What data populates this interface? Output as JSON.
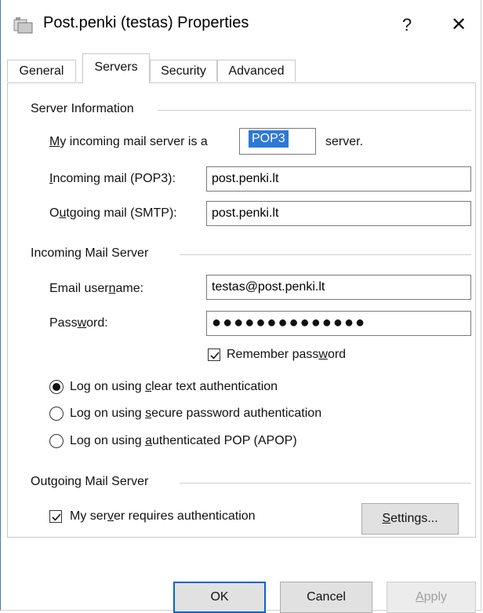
{
  "window": {
    "title": "Post.penki (testas) Properties",
    "help_label": "?",
    "close_label": "✕"
  },
  "tabs": [
    {
      "label": "General",
      "active": false
    },
    {
      "label": "Servers",
      "active": true
    },
    {
      "label": "Security",
      "active": false
    },
    {
      "label": "Advanced",
      "active": false
    }
  ],
  "server_info": {
    "group_label": "Server Information",
    "incoming_type_label_pre": "My incoming mail server is a",
    "incoming_type_value": "POP3",
    "incoming_type_label_post": "server.",
    "incoming_mail_label": "Incoming mail (POP3):",
    "incoming_mail_value": "post.penki.lt",
    "outgoing_mail_label": "Outgoing mail (SMTP):",
    "outgoing_mail_value": "post.penki.lt"
  },
  "incoming_server": {
    "group_label": "Incoming Mail Server",
    "username_label": "Email username:",
    "username_value": "testas@post.penki.lt",
    "password_label": "Password:",
    "password_value": "●●●●●●●●●●●●●●",
    "remember_password_label": "Remember password",
    "remember_password_checked": true,
    "auth_options": [
      {
        "label": "Log on using clear text authentication",
        "selected": true
      },
      {
        "label": "Log on using secure password authentication",
        "selected": false
      },
      {
        "label": "Log on using authenticated POP (APOP)",
        "selected": false
      }
    ]
  },
  "outgoing_server": {
    "group_label": "Outgoing Mail Server",
    "requires_auth_label": "My server requires authentication",
    "requires_auth_checked": true,
    "settings_button": "Settings..."
  },
  "footer": {
    "ok_label": "OK",
    "cancel_label": "Cancel",
    "apply_label": "Apply"
  },
  "colors": {
    "selection": "#2e78d6",
    "default_button_border": "#0a64c8",
    "window_border": "#4a7ab8"
  }
}
